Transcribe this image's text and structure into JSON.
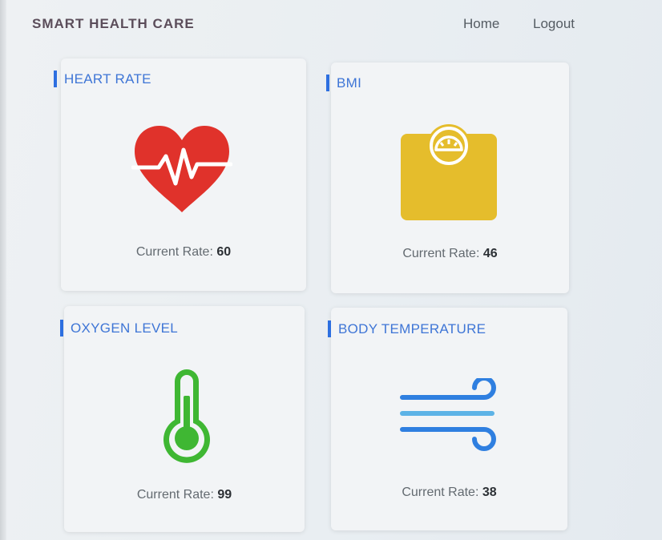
{
  "navbar": {
    "brand": "SMART HEALTH CARE",
    "links": [
      "Home",
      "Logout"
    ]
  },
  "cards": [
    {
      "title": "HEART RATE",
      "icon": "heart-pulse-icon",
      "reading_label": "Current Rate:",
      "value": "60",
      "icon_color": "#e0322b"
    },
    {
      "title": "BMI",
      "icon": "weighing-scale-icon",
      "reading_label": "Current Rate:",
      "value": "46",
      "icon_color": "#e5bd2c"
    },
    {
      "title": "OXYGEN LEVEL",
      "icon": "thermometer-icon",
      "reading_label": "Current Rate:",
      "value": "99",
      "icon_color": "#3fb733"
    },
    {
      "title": "BODY TEMPERATURE",
      "icon": "wind-icon",
      "reading_label": "Current Rate:",
      "value": "38",
      "icon_color": "#2f7fe0"
    }
  ],
  "colors": {
    "accent": "#3e75d6",
    "brand_text": "#5b4d5a"
  }
}
